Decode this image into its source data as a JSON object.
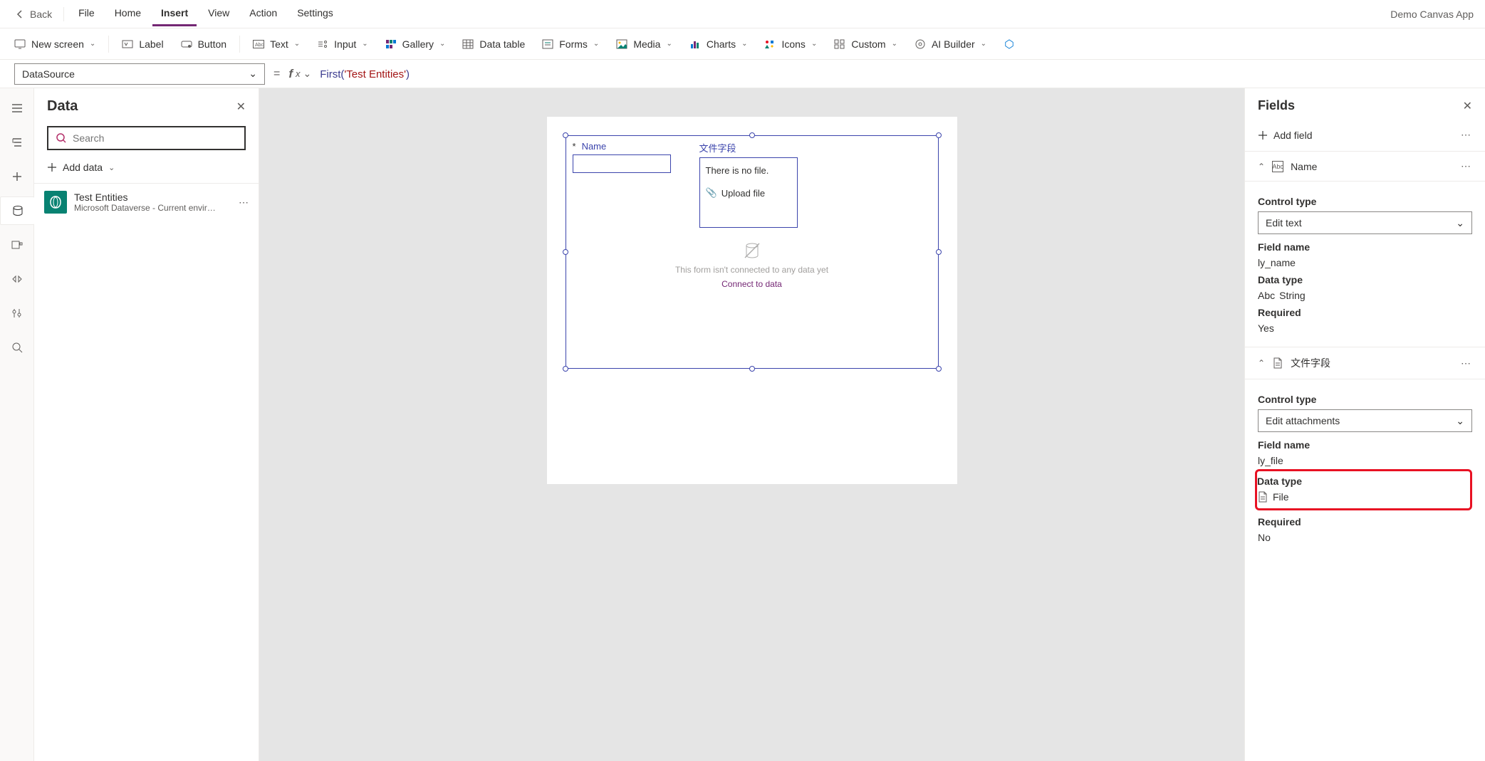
{
  "app_name": "Demo Canvas App",
  "top_menu": {
    "back": "Back",
    "tabs": [
      "File",
      "Home",
      "Insert",
      "View",
      "Action",
      "Settings"
    ],
    "active_tab_index": 2
  },
  "ribbon": {
    "new_screen": "New screen",
    "label": "Label",
    "button": "Button",
    "text": "Text",
    "input": "Input",
    "gallery": "Gallery",
    "data_table": "Data table",
    "forms": "Forms",
    "media": "Media",
    "charts": "Charts",
    "icons": "Icons",
    "custom": "Custom",
    "ai_builder": "AI Builder"
  },
  "formula": {
    "property": "DataSource",
    "eq": "=",
    "fn": "First",
    "str": "'Test Entities'"
  },
  "data_panel": {
    "title": "Data",
    "search_placeholder": "Search",
    "add_data": "Add data",
    "items": [
      {
        "name": "Test Entities",
        "subtitle": "Microsoft Dataverse - Current environm..."
      }
    ]
  },
  "canvas": {
    "fields": {
      "name_label": "Name",
      "file_label": "文件字段",
      "no_file": "There is no file.",
      "upload": "Upload file"
    },
    "empty_msg": "This form isn't connected to any data yet",
    "connect": "Connect to data"
  },
  "fields_panel": {
    "title": "Fields",
    "add_field": "Add field",
    "cards": [
      {
        "display_name": "Name",
        "icon": "Abc",
        "control_type_label": "Control type",
        "control_type": "Edit text",
        "field_name_label": "Field name",
        "field_name": "ly_name",
        "data_type_label": "Data type",
        "data_type": "String",
        "data_type_icon": "Abc",
        "required_label": "Required",
        "required": "Yes"
      },
      {
        "display_name": "文件字段",
        "icon": "file",
        "control_type_label": "Control type",
        "control_type": "Edit attachments",
        "field_name_label": "Field name",
        "field_name": "ly_file",
        "data_type_label": "Data type",
        "data_type": "File",
        "data_type_icon": "file",
        "required_label": "Required",
        "required": "No"
      }
    ]
  }
}
